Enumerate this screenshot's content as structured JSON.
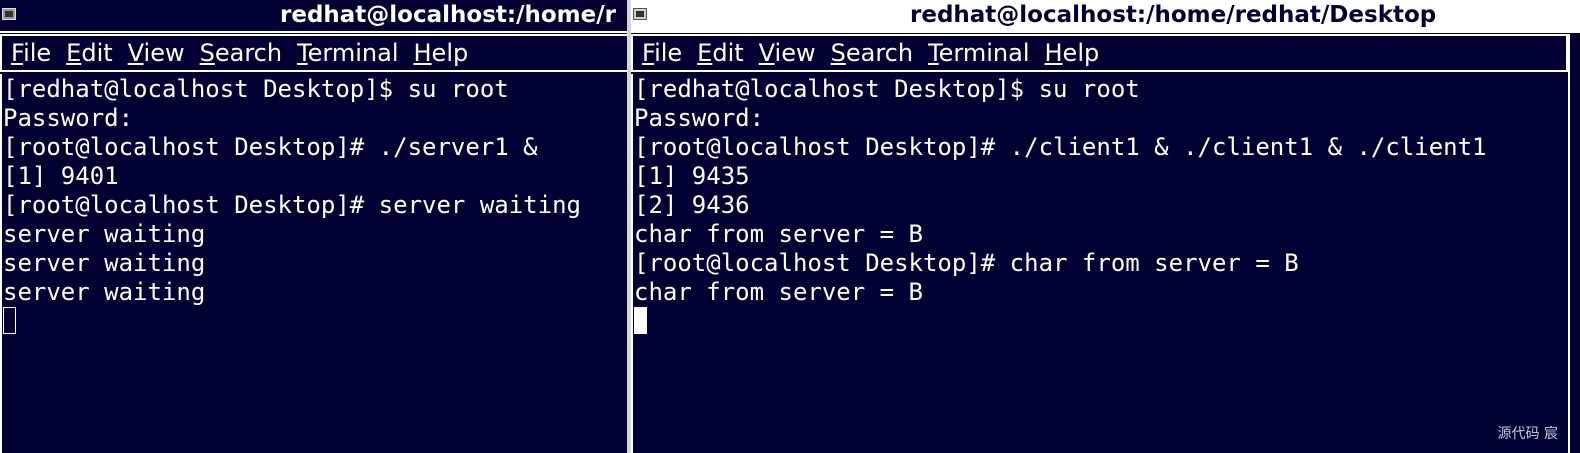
{
  "left_window": {
    "title": "redhat@localhost:/home/r",
    "menu": [
      {
        "mnemonic": "F",
        "rest": "ile"
      },
      {
        "mnemonic": "E",
        "rest": "dit"
      },
      {
        "mnemonic": "V",
        "rest": "iew"
      },
      {
        "mnemonic": "S",
        "rest": "earch"
      },
      {
        "mnemonic": "T",
        "rest": "erminal"
      },
      {
        "mnemonic": "H",
        "rest": "elp"
      }
    ],
    "lines": [
      "[redhat@localhost Desktop]$ su root",
      "Password:",
      "[root@localhost Desktop]# ./server1 &",
      "[1] 9401",
      "[root@localhost Desktop]# server waiting",
      "server waiting",
      "server waiting",
      "server waiting"
    ]
  },
  "right_window": {
    "title": "redhat@localhost:/home/redhat/Desktop",
    "menu": [
      {
        "mnemonic": "F",
        "rest": "ile"
      },
      {
        "mnemonic": "E",
        "rest": "dit"
      },
      {
        "mnemonic": "V",
        "rest": "iew"
      },
      {
        "mnemonic": "S",
        "rest": "earch"
      },
      {
        "mnemonic": "T",
        "rest": "erminal"
      },
      {
        "mnemonic": "H",
        "rest": "elp"
      }
    ],
    "lines": [
      "[redhat@localhost Desktop]$ su root",
      "Password:",
      "[root@localhost Desktop]# ./client1 & ./client1 & ./client1",
      "[1] 9435",
      "[2] 9436",
      "char from server = B",
      "[root@localhost Desktop]# char from server = B",
      "char from server = B"
    ]
  },
  "watermark": "源代码  宸",
  "colors": {
    "terminal_bg": "#000033",
    "terminal_fg": "#ffffff",
    "active_title_bg": "#ffffff"
  }
}
